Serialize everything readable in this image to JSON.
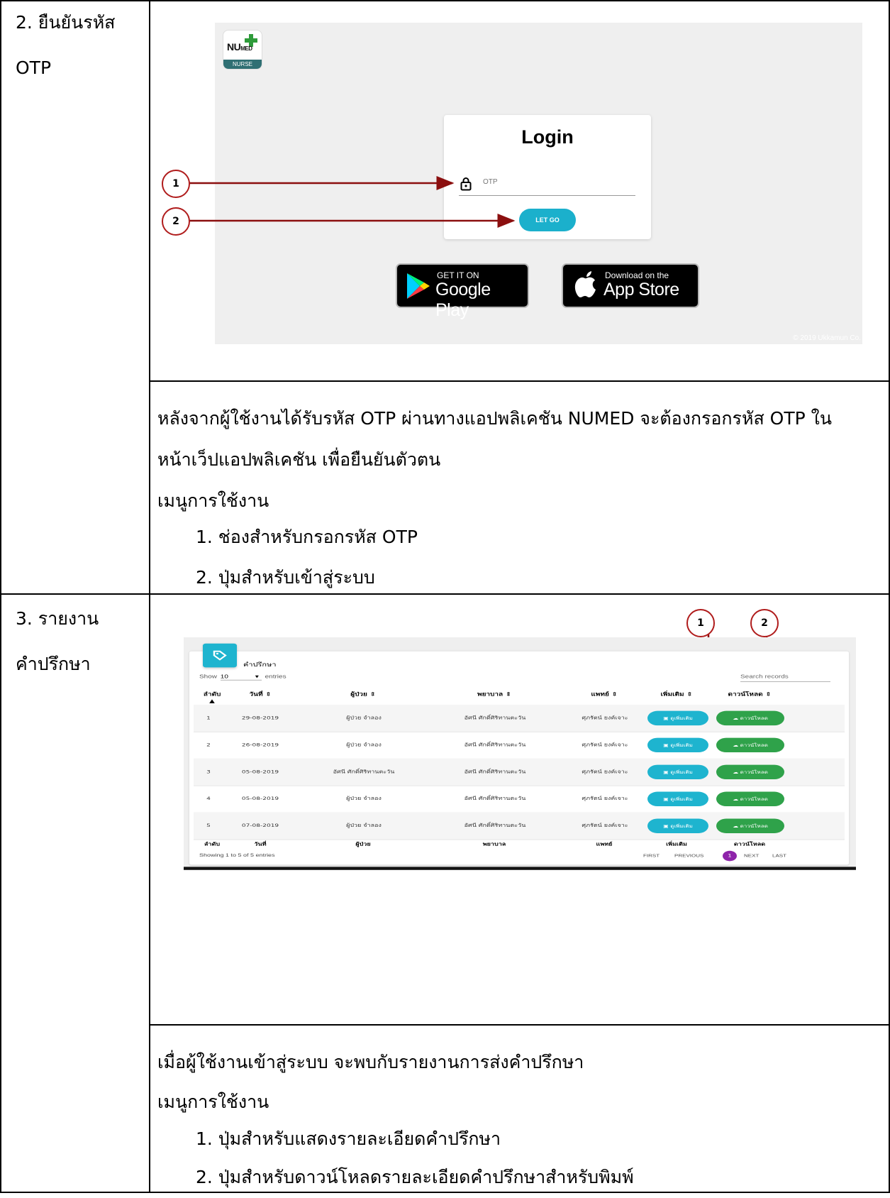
{
  "section2": {
    "label_line1": "2. ยืนยันรหัส",
    "label_line2": "OTP",
    "screenshot": {
      "logo_text": "NU",
      "logo_sub": "MED",
      "logo_band": "NURSE",
      "login_title": "Login",
      "otp_placeholder": "OTP",
      "submit_label": "LET GO",
      "google_small": "GET IT ON",
      "google_big": "Google Play",
      "apple_small": "Download on the",
      "apple_big": "App Store",
      "copyright": "© 2019 Ukkamun Co."
    },
    "callouts": [
      "1",
      "2"
    ],
    "desc_line1": "หลังจากผู้ใช้งานได้รับรหัส OTP ผ่านทางแอปพลิเคชัน NUMED จะต้องกรอกรหัส OTP ใน",
    "desc_line2": "หน้าเว็ปแอปพลิเคชัน เพื่อยืนยันตัวตน",
    "menu_heading": "เมนูการใช้งาน",
    "menu_items": [
      "1.  ช่องสำหรับกรอกรหัส OTP",
      "2.  ปุ่มสำหรับเข้าสู่ระบบ"
    ]
  },
  "section3": {
    "label_line1": "3. รายงาน",
    "label_line2": "คำปรึกษา",
    "screenshot": {
      "title": "คำปรึกษา",
      "show": "Show",
      "entries_value": "10",
      "entries": "entries",
      "search_placeholder": "Search records",
      "headers": [
        "ลำดับ",
        "วันที่ ⇕",
        "ผู้ป่วย ⇕",
        "พยาบาล ⇕",
        "แพทย์ ⇕",
        "เพิ่มเติม ⇕",
        "ดาวน์โหลด ⇕"
      ],
      "footers": [
        "ลำดับ",
        "วันที่",
        "ผู้ป่วย",
        "พยาบาล",
        "แพทย์",
        "เพิ่มเติม",
        "ดาวน์โหลด"
      ],
      "rows": [
        [
          "1",
          "29-08-2019",
          "ผู้ป่วย จำลอง",
          "อัศนี ศักดิ์ศิริทานตะวัน",
          "ศุภรัตน์ ยงค์เจาะ"
        ],
        [
          "2",
          "26-08-2019",
          "ผู้ป่วย จำลอง",
          "อัศนี ศักดิ์ศิริทานตะวัน",
          "ศุภรัตน์ ยงค์เจาะ"
        ],
        [
          "3",
          "05-08-2019",
          "อัศนี ศักดิ์ศิริทานตะวัน",
          "อัศนี ศักดิ์ศิริทานตะวัน",
          "ศุภรัตน์ ยงค์เจาะ"
        ],
        [
          "4",
          "05-08-2019",
          "ผู้ป่วย จำลอง",
          "อัศนี ศักดิ์ศิริทานตะวัน",
          "ศุภรัตน์ ยงค์เจาะ"
        ],
        [
          "5",
          "07-08-2019",
          "ผู้ป่วย จำลอง",
          "อัศนี ศักดิ์ศิริทานตะวัน",
          "ศุภรัตน์ ยงค์เจาะ"
        ]
      ],
      "more_label": "ดูเพิ่มเติม",
      "download_label": "ดาวน์โหลด",
      "showing": "Showing 1 to 5 of 5 entries",
      "pager": {
        "first": "FIRST",
        "previous": "PREVIOUS",
        "current": "1",
        "next": "NEXT",
        "last": "LAST"
      }
    },
    "callouts": [
      "1",
      "2"
    ],
    "desc_line1": "เมื่อผู้ใช้งานเข้าสู่ระบบ จะพบกับรายงานการส่งคำปรึกษา",
    "menu_heading": "เมนูการใช้งาน",
    "menu_items": [
      "1.  ปุ่มสำหรับแสดงรายละเอียดคำปรึกษา",
      "2.  ปุ่มสำหรับดาวน์โหลดรายละเอียดคำปรึกษาสำหรับพิมพ์"
    ]
  },
  "colors": {
    "accent_cyan": "#1eb4cf",
    "download_green": "#2fa24a",
    "callout_red": "#b01c1c",
    "page_purple": "#8e24aa"
  }
}
